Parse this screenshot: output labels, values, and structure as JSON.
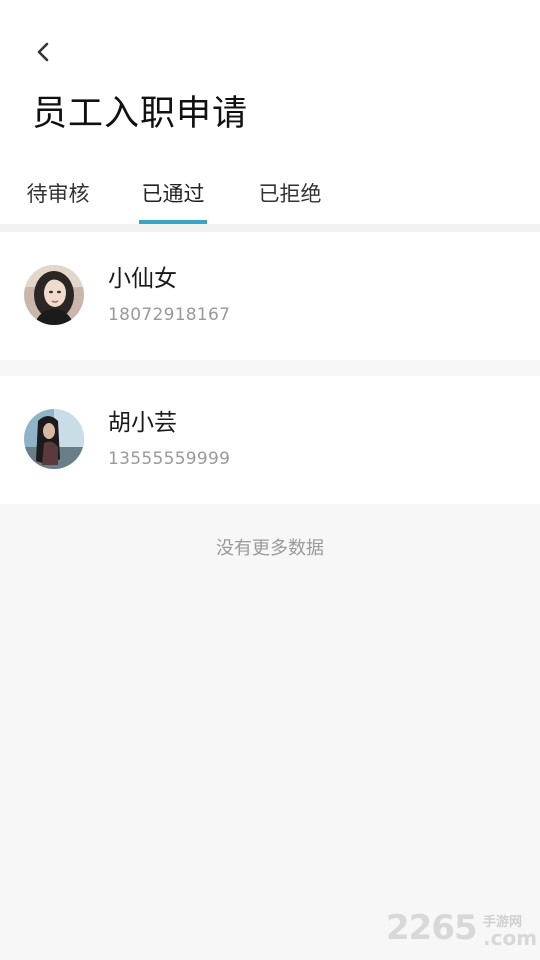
{
  "header": {
    "title": "员工入职申请",
    "back_icon": "chevron-left-icon"
  },
  "tabs": [
    {
      "label": "待审核",
      "active": false
    },
    {
      "label": "已通过",
      "active": true
    },
    {
      "label": "已拒绝",
      "active": false
    }
  ],
  "colors": {
    "accent": "#3aa3c8",
    "background": "#f7f7f7",
    "card": "#ffffff",
    "secondary_text": "#999999"
  },
  "employees": [
    {
      "name": "小仙女",
      "phone": "18072918167"
    },
    {
      "name": "胡小芸",
      "phone": "13555559999"
    }
  ],
  "list_footer": "没有更多数据",
  "watermark": {
    "number": "2265",
    "site": "手游网",
    "suffix": ".com"
  }
}
